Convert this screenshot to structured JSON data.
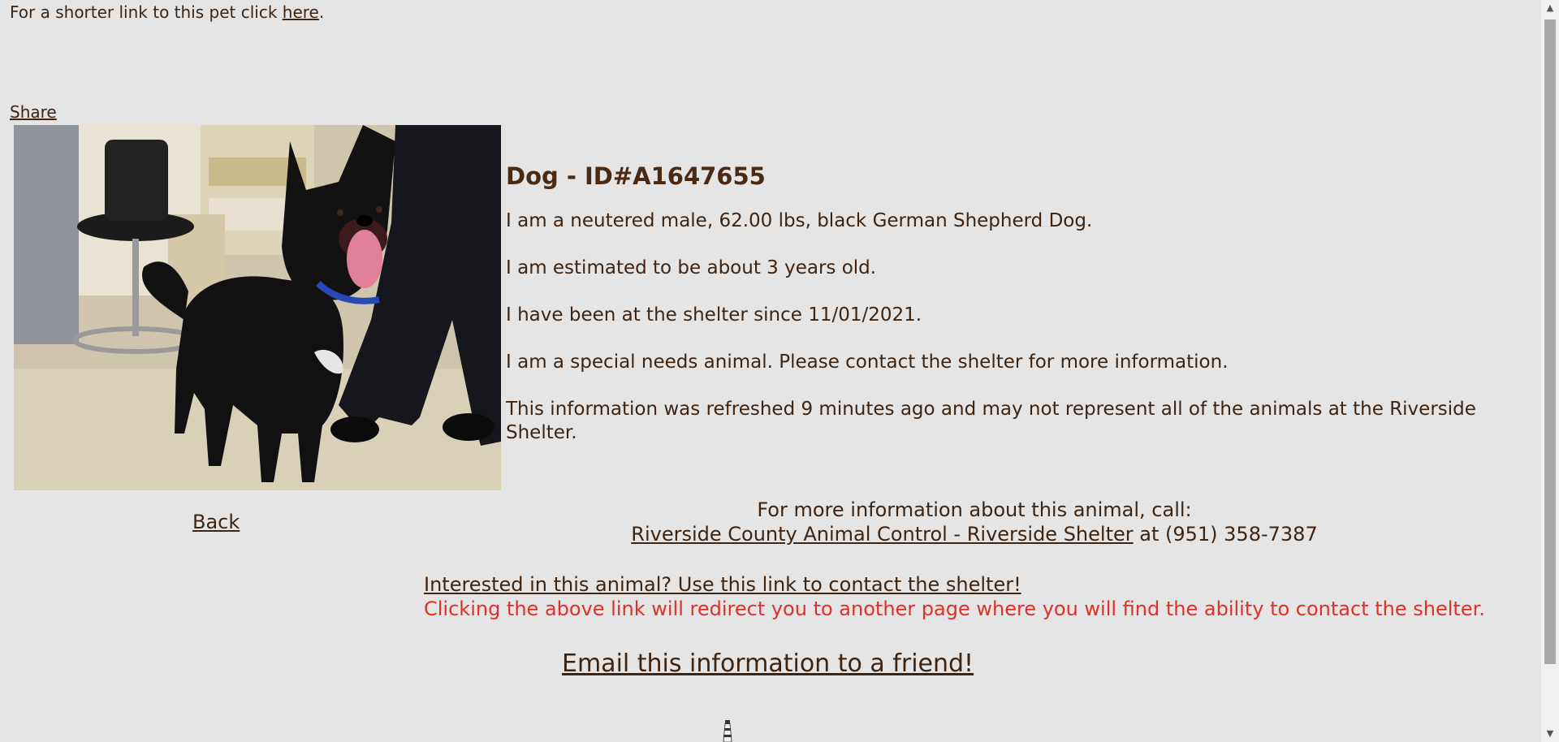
{
  "top": {
    "short_link_prefix": "For a shorter link to this pet click ",
    "short_link_label": "here",
    "short_link_suffix": "."
  },
  "share_label": "Share",
  "photo": {
    "alt": "Black German Shepherd Dog photo"
  },
  "animal": {
    "heading": "Dog - ID#A1647655",
    "line1": "I am a neutered male, 62.00 lbs, black German Shepherd Dog.",
    "line2": "I am estimated to be about 3 years old.",
    "line3": "I have been at the shelter since 11/01/2021.",
    "line4": "I am a special needs animal. Please contact the shelter for more information.",
    "line5": "This information was refreshed 9 minutes ago and may not represent all of the animals at the Riverside Shelter."
  },
  "back_label": "Back",
  "contact": {
    "call_text": "For more information about this animal, call:",
    "shelter_link": "Riverside County Animal Control - Riverside Shelter",
    "phone_text": " at (951) 358-7387"
  },
  "interest": {
    "link_label": "Interested in this animal? Use this link to contact the shelter!",
    "warning": "Clicking the above link will redirect you to another page where you will find the ability to contact the shelter."
  },
  "email_label": "Email this information to a friend!",
  "colors": {
    "background": "#e5e5e5",
    "text": "#3f2410",
    "warning": "#e0302a"
  },
  "icons": {
    "scroll_up": "scroll-up-arrow-icon",
    "scroll_down": "scroll-down-arrow-icon",
    "lighthouse": "lighthouse-icon"
  }
}
